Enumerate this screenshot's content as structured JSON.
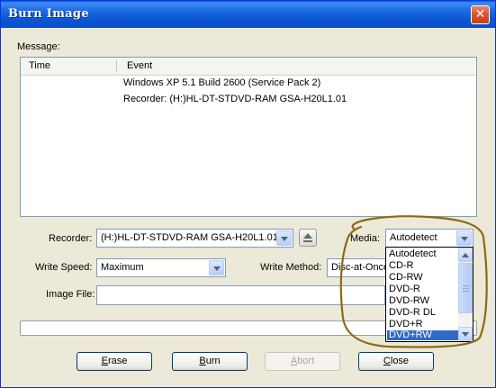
{
  "window": {
    "title": "Burn Image",
    "close_glyph": "✕"
  },
  "message": {
    "label": "Message:",
    "columns": [
      "Time",
      "Event"
    ],
    "rows": [
      {
        "time": "",
        "event": "Windows XP 5.1 Build 2600 (Service Pack 2)"
      },
      {
        "time": "",
        "event": "Recorder: (H:)HL-DT-STDVD-RAM GSA-H20L1.01"
      }
    ]
  },
  "recorder": {
    "label": "Recorder:",
    "value": "(H:)HL-DT-STDVD-RAM GSA-H20L1.01",
    "eject_icon": "eject-icon"
  },
  "media": {
    "label": "Media:",
    "value": "Autodetect",
    "options": [
      "Autodetect",
      "CD-R",
      "CD-RW",
      "DVD-R",
      "DVD-RW",
      "DVD-R DL",
      "DVD+R",
      "DVD+RW"
    ],
    "highlighted": "DVD+RW"
  },
  "write_speed": {
    "label": "Write Speed:",
    "value": "Maximum"
  },
  "write_method": {
    "label": "Write Method:",
    "value": "Disc-at-Once"
  },
  "image_file": {
    "label": "Image File:",
    "value": ""
  },
  "progress": {
    "fraction": 0
  },
  "buttons": {
    "erase": {
      "u": "E",
      "rest": "rase",
      "enabled": true
    },
    "burn": {
      "u": "B",
      "rest": "urn",
      "enabled": true
    },
    "abort": {
      "u": "A",
      "rest": "bort",
      "enabled": false
    },
    "close": {
      "u": "C",
      "rest": "lose",
      "enabled": true
    }
  },
  "colors": {
    "title_bar": "#0a5fd8",
    "selection": "#316ac5",
    "annotation": "#8b6a14"
  }
}
